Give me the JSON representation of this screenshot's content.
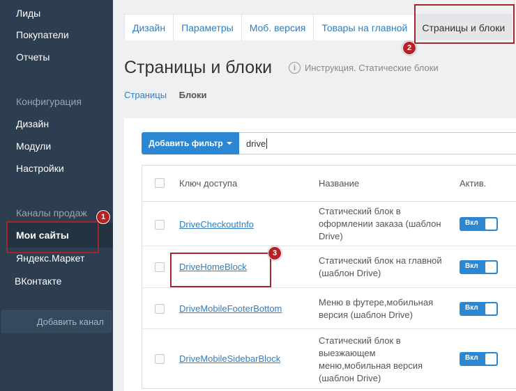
{
  "sidebar": {
    "items_top": [
      "Лиды",
      "Покупатели",
      "Отчеты"
    ],
    "section_config": "Конфигурация",
    "items_config": [
      "Дизайн",
      "Модули",
      "Настройки"
    ],
    "section_channels": "Каналы продаж",
    "items_channels": [
      "Мои сайты",
      "Яндекс.Маркет",
      "ВКонтакте"
    ],
    "add_channel": "Добавить канал"
  },
  "tabs": [
    "Дизайн",
    "Параметры",
    "Моб. версия",
    "Товары на главной",
    "Страницы и блоки"
  ],
  "page": {
    "title": "Страницы и блоки",
    "instruction": "Инструкция. Статические блоки",
    "info_icon": "i"
  },
  "subnav": {
    "pages": "Страницы",
    "blocks": "Блоки"
  },
  "filter": {
    "button": "Добавить фильтр",
    "value": "drive"
  },
  "table": {
    "headers": {
      "key": "Ключ доступа",
      "name": "Название",
      "active": "Актив."
    },
    "rows": [
      {
        "key": "DriveCheckoutInfo",
        "name": "Статический блок в оформлении заказа (шаблон Drive)",
        "toggle": "Вкл"
      },
      {
        "key": "DriveHomeBlock",
        "name": "Статический блок на главной (шаблон Drive)",
        "toggle": "Вкл"
      },
      {
        "key": "DriveMobileFooterBottom",
        "name": "Меню в футере,мобильная версия (шаблон Drive)",
        "toggle": "Вкл"
      },
      {
        "key": "DriveMobileSidebarBlock",
        "name": "Статический блок в выезжающем меню,мобильная версия (шаблон Drive)",
        "toggle": "Вкл"
      }
    ]
  },
  "annotations": [
    "1",
    "2",
    "3"
  ],
  "colors": {
    "sidebar_bg": "#2c3e50",
    "accent": "#2b87d1",
    "annotation": "#b72025"
  }
}
